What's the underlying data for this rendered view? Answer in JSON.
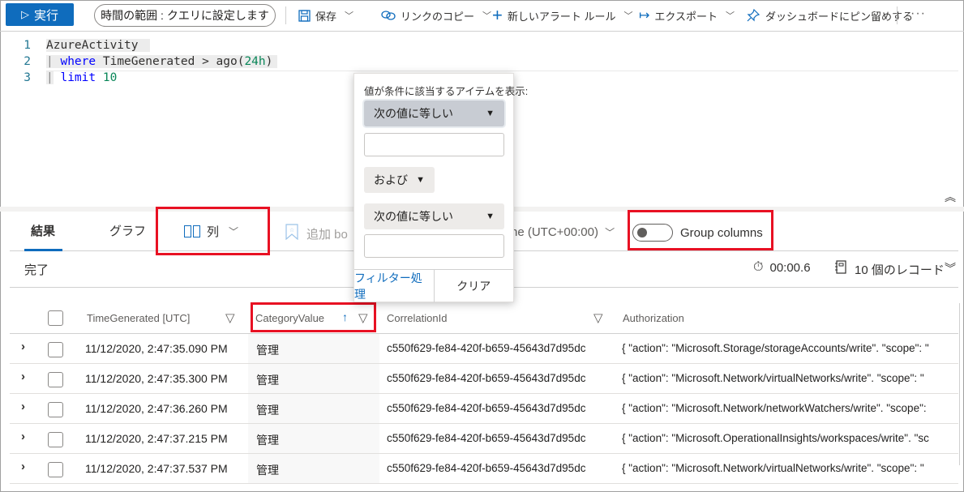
{
  "toolbar": {
    "run_label": "実行",
    "time_range_label": "時間の範囲 : クエリに設定します",
    "save_label": "保存",
    "copy_link_label": "リンクのコピー",
    "new_alert_label": "新しいアラート ルール",
    "export_label": "エクスポート",
    "pin_label": "ダッシュボードにピン留めする",
    "more_label": "···"
  },
  "editor": {
    "lines": [
      {
        "number": "1",
        "table": "AzureActivity"
      },
      {
        "number": "2",
        "pipe": "|",
        "keyword": "where",
        "rest": " TimeGenerated > ago(",
        "num": "24h",
        "close": ")"
      },
      {
        "number": "3",
        "pipe": "|",
        "keyword": "limit",
        "num": "10"
      }
    ]
  },
  "results": {
    "tabs": [
      {
        "label": "結果",
        "active": true
      },
      {
        "label": "グラフ",
        "active": false
      }
    ],
    "columns_button_label": "列",
    "add_bookmark_label": "追加 bo",
    "timezone_label": "ne (UTC+00:00)",
    "group_columns_label": "Group columns",
    "group_columns_on": false,
    "status": "完了",
    "duration": "00:00.6",
    "record_count": "10 個のレコード"
  },
  "table": {
    "columns": [
      {
        "label": "TimeGenerated [UTC]"
      },
      {
        "label": "CategoryValue",
        "sorted": "ascending"
      },
      {
        "label": "CorrelationId"
      },
      {
        "label": "Authorization"
      }
    ],
    "rows": [
      {
        "time": "11/12/2020, 2:47:35.090 PM",
        "category": "管理",
        "correlation": "c550f629-fe84-420f-b659-45643d7d95dc",
        "authorization": "{ \"action\": \"Microsoft.Storage/storageAccounts/write\". \"scope\": \""
      },
      {
        "time": "11/12/2020, 2:47:35.300 PM",
        "category": "管理",
        "correlation": "c550f629-fe84-420f-b659-45643d7d95dc",
        "authorization": "{ \"action\": \"Microsoft.Network/virtualNetworks/write\". \"scope\": \""
      },
      {
        "time": "11/12/2020, 2:47:36.260 PM",
        "category": "管理",
        "correlation": "c550f629-fe84-420f-b659-45643d7d95dc",
        "authorization": "{ \"action\": \"Microsoft.Network/networkWatchers/write\". \"scope\":"
      },
      {
        "time": "11/12/2020, 2:47:37.215 PM",
        "category": "管理",
        "correlation": "c550f629-fe84-420f-b659-45643d7d95dc",
        "authorization": "{ \"action\": \"Microsoft.OperationalInsights/workspaces/write\". \"sc"
      },
      {
        "time": "11/12/2020, 2:47:37.537 PM",
        "category": "管理",
        "correlation": "c550f629-fe84-420f-b659-45643d7d95dc",
        "authorization": "{ \"action\": \"Microsoft.Network/virtualNetworks/write\". \"scope\": \""
      }
    ]
  },
  "filter_popup": {
    "title": "値が条件に該当するアイテムを表示:",
    "condition1": "次の値に等しい",
    "value1": "",
    "logic": "および",
    "condition2": "次の値に等しい",
    "value2": "",
    "filter_label": "フィルター処理",
    "clear_label": "クリア"
  }
}
